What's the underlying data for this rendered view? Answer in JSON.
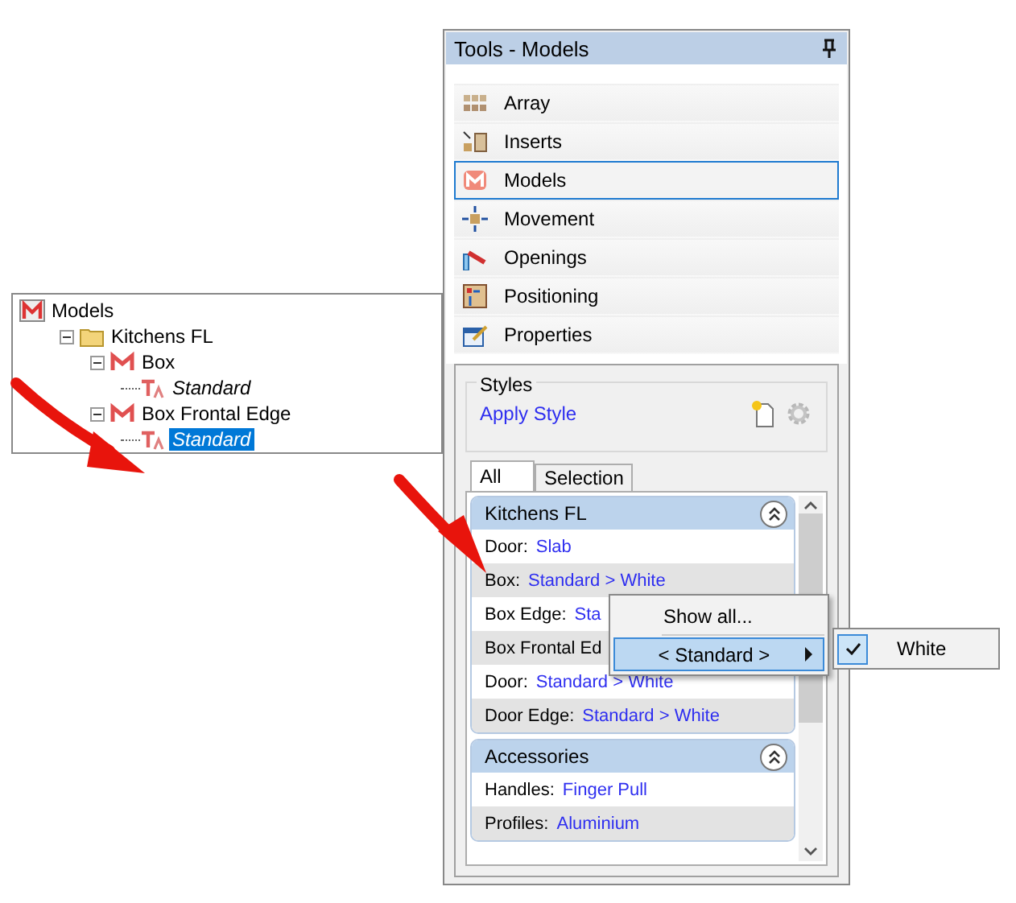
{
  "tree": {
    "nodes": [
      {
        "label": "Models",
        "kind": "root",
        "selected": false,
        "children": [
          {
            "label": "Kitchens FL",
            "kind": "folder",
            "expanded": true,
            "selected": false,
            "children": [
              {
                "label": "Box",
                "kind": "model",
                "expanded": true,
                "selected": false,
                "children": [
                  {
                    "label": "Standard",
                    "kind": "style",
                    "selected": false
                  }
                ]
              },
              {
                "label": "Box Frontal Edge",
                "kind": "model",
                "expanded": true,
                "selected": false,
                "children": [
                  {
                    "label": "Standard",
                    "kind": "style",
                    "selected": true
                  }
                ]
              }
            ]
          }
        ]
      }
    ]
  },
  "tools_panel": {
    "title": "Tools - Models",
    "items": [
      {
        "label": "Array",
        "kind": "array",
        "selected": false
      },
      {
        "label": "Inserts",
        "kind": "inserts",
        "selected": false
      },
      {
        "label": "Models",
        "kind": "models",
        "selected": true
      },
      {
        "label": "Movement",
        "kind": "movement",
        "selected": false
      },
      {
        "label": "Openings",
        "kind": "openings",
        "selected": false
      },
      {
        "label": "Positioning",
        "kind": "positioning",
        "selected": false
      },
      {
        "label": "Properties",
        "kind": "properties",
        "selected": false
      }
    ],
    "styles": {
      "legend": "Styles",
      "link": "Apply Style"
    },
    "tabs": [
      {
        "label": "All",
        "selected": true
      },
      {
        "label": "Selection",
        "selected": false
      }
    ],
    "groups": [
      {
        "title": "Kitchens FL",
        "expanded": true,
        "rows": [
          {
            "label": "Door:",
            "value": "Slab"
          },
          {
            "label": "Box:",
            "value": "Standard > White"
          },
          {
            "label": "Box Edge:",
            "value": "Sta"
          },
          {
            "label": "Box Frontal Ed"
          },
          {
            "label": "Door:",
            "value": "Standard > White"
          },
          {
            "label": "Door Edge:",
            "value": "Standard > White"
          }
        ]
      },
      {
        "title": "Accessories",
        "expanded": true,
        "rows": [
          {
            "label": "Handles:",
            "value": "Finger Pull"
          },
          {
            "label": "Profiles:",
            "value": "Aluminium"
          }
        ]
      }
    ]
  },
  "context_menu": {
    "items": [
      {
        "label": "Show all...",
        "kind": "item",
        "selected": false
      },
      {
        "label": "< Standard >",
        "kind": "submenu",
        "selected": true
      }
    ],
    "submenu": [
      {
        "label": "White",
        "checked": true
      }
    ]
  }
}
